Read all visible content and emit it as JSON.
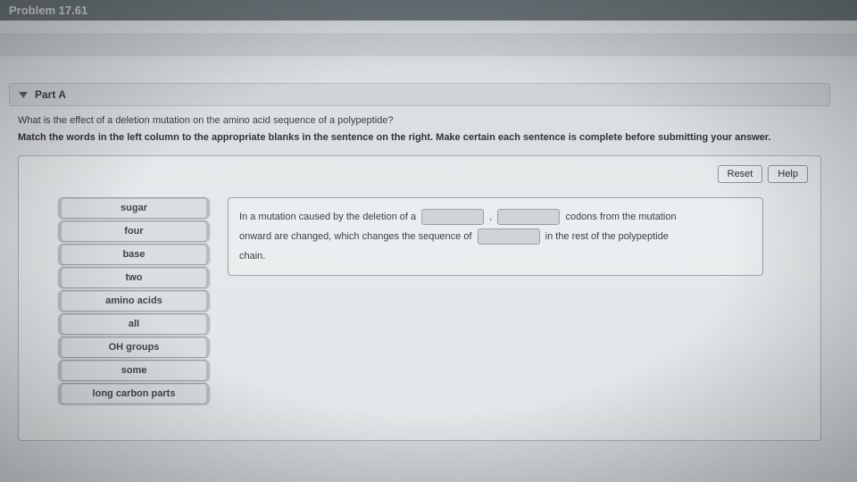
{
  "header": {
    "problem_label": "Problem 17.61"
  },
  "part": {
    "title": "Part A",
    "question": "What is the effect of a deletion mutation on the amino acid sequence of a polypeptide?",
    "instruction": "Match the words in the left column to the appropriate blanks in the sentence on the right. Make certain each sentence is complete before submitting your answer."
  },
  "buttons": {
    "reset": "Reset",
    "help": "Help"
  },
  "word_bank": [
    "sugar",
    "four",
    "base",
    "two",
    "amino acids",
    "all",
    "OH groups",
    "some",
    "long carbon parts"
  ],
  "sentence": {
    "seg1": "In a mutation caused by the deletion of a",
    "comma": ",",
    "seg2": "codons from the mutation",
    "seg3": "onward are changed, which changes the sequence of",
    "seg4": "in the rest of the polypeptide",
    "seg5": "chain."
  }
}
